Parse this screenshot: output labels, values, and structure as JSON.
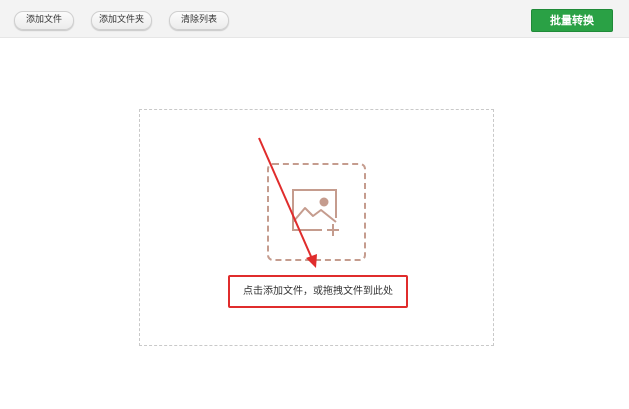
{
  "toolbar": {
    "add_file_label": "添加文件",
    "add_folder_label": "添加文件夹",
    "clear_list_label": "清除列表",
    "convert_label": "批量转换"
  },
  "drop_zone": {
    "hint": "点击添加文件，或拖拽文件到此处",
    "icon": "image-add-icon"
  },
  "colors": {
    "accent_green": "#2aa145",
    "highlight_red": "#e02c2c",
    "icon_brown": "#c59c8e"
  }
}
